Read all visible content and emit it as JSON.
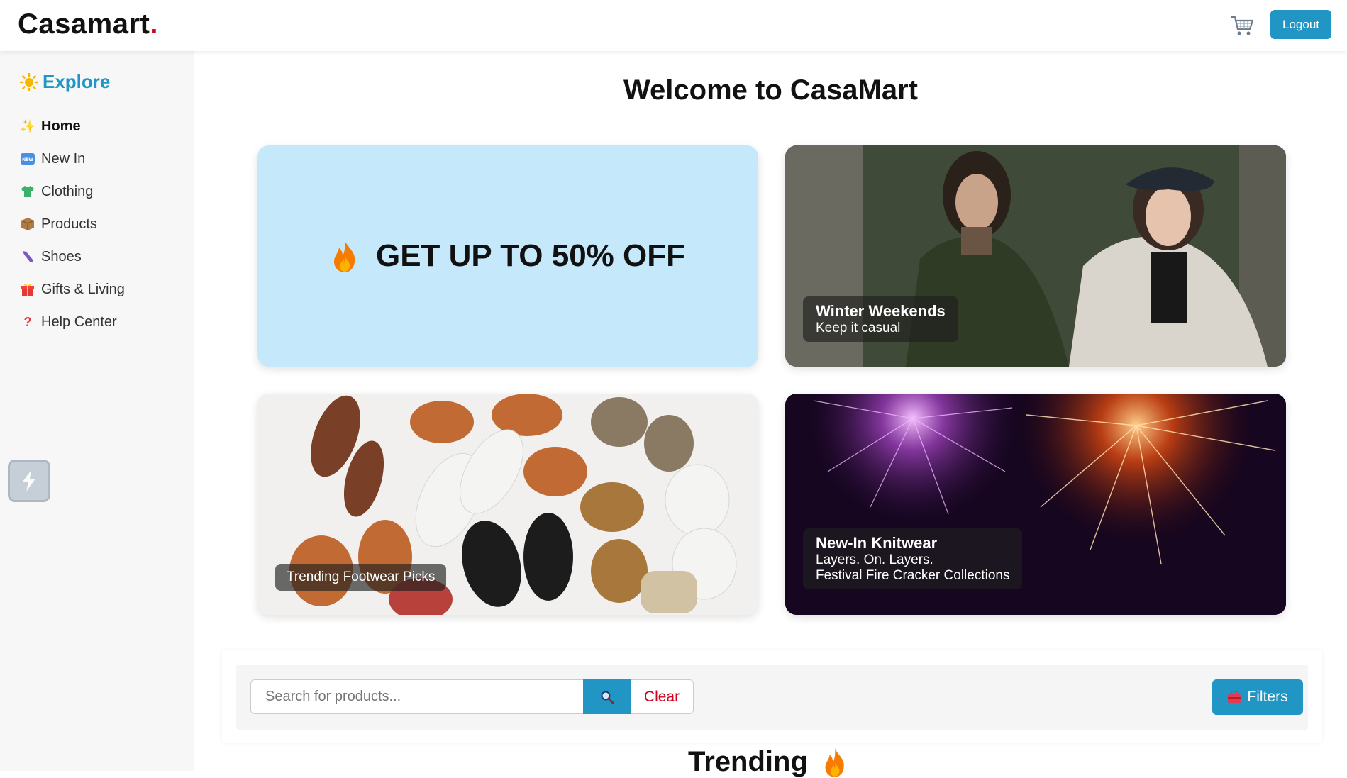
{
  "header": {
    "brand": "Casamart",
    "brand_dot": ".",
    "logout_label": "Logout"
  },
  "sidebar": {
    "heading": "Explore",
    "items": [
      {
        "label": "Home",
        "icon": "sparkles-icon"
      },
      {
        "label": "New In",
        "icon": "new-badge-icon"
      },
      {
        "label": "Clothing",
        "icon": "tshirt-icon"
      },
      {
        "label": "Products",
        "icon": "package-icon"
      },
      {
        "label": "Shoes",
        "icon": "shoe-icon"
      },
      {
        "label": "Gifts & Living",
        "icon": "gift-icon"
      },
      {
        "label": "Help Center",
        "icon": "question-icon"
      }
    ]
  },
  "main": {
    "title": "Welcome to CasaMart",
    "cards": [
      {
        "title": "GET UP TO 50% OFF"
      },
      {
        "title": "Winter Weekends",
        "subtitle": "Keep it casual"
      },
      {
        "title": "Trending Footwear Picks"
      },
      {
        "title": "New-In Knitwear",
        "subtitle": "Layers. On. Layers.",
        "subtitle2": "Festival Fire Cracker Collections"
      }
    ],
    "search": {
      "placeholder": "Search for products...",
      "value": "",
      "clear_label": "Clear",
      "filters_label": "Filters"
    },
    "trending_title": "Trending"
  },
  "colors": {
    "accent": "#2196c4",
    "brand_dot": "#d0021b",
    "promo_bg": "#c6e8fb"
  }
}
